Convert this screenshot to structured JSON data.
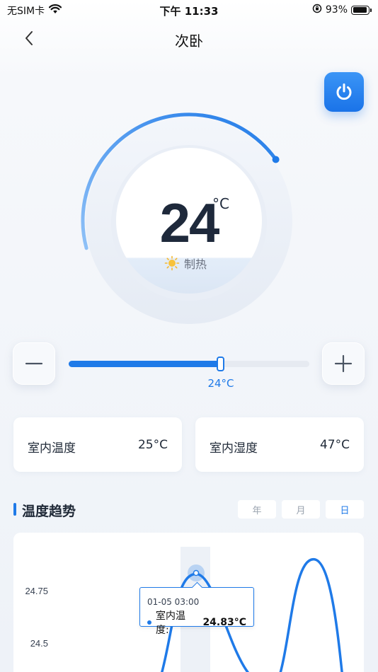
{
  "status": {
    "carrier": "无SIM卡",
    "time": "下午 11:33",
    "battery": "93%",
    "battery_level": 0.93
  },
  "nav": {
    "title": "次卧",
    "back_icon": "chevron-left-icon"
  },
  "power": {
    "icon": "power-icon"
  },
  "thermostat": {
    "temperature": "24",
    "unit": "°C",
    "mode_icon": "sun-icon",
    "mode": "制热",
    "progress": 0.62
  },
  "slider": {
    "value_label": "24°C",
    "fraction": 0.63,
    "minus_icon": "minus-icon",
    "plus_icon": "plus-icon"
  },
  "cards": [
    {
      "label": "室内温度",
      "value": "25°C"
    },
    {
      "label": "室内湿度",
      "value": "47°C"
    }
  ],
  "trend": {
    "title": "温度趋势",
    "tabs": [
      "年",
      "月",
      "日"
    ],
    "active_tab": "日"
  },
  "chart_data": {
    "type": "line",
    "y_ticks": [
      "24.75",
      "24.5"
    ],
    "series": [
      {
        "values": [
          24.3,
          24.83,
          24.3,
          24.9
        ]
      }
    ],
    "tooltip": {
      "date": "01-05 03:00",
      "series_label": "室内温度:",
      "value": "24.83°C"
    },
    "accent": "#1f7ae8"
  },
  "colors": {
    "accent": "#1f7ae8",
    "text": "#1f2937",
    "muted": "#6b7280"
  }
}
